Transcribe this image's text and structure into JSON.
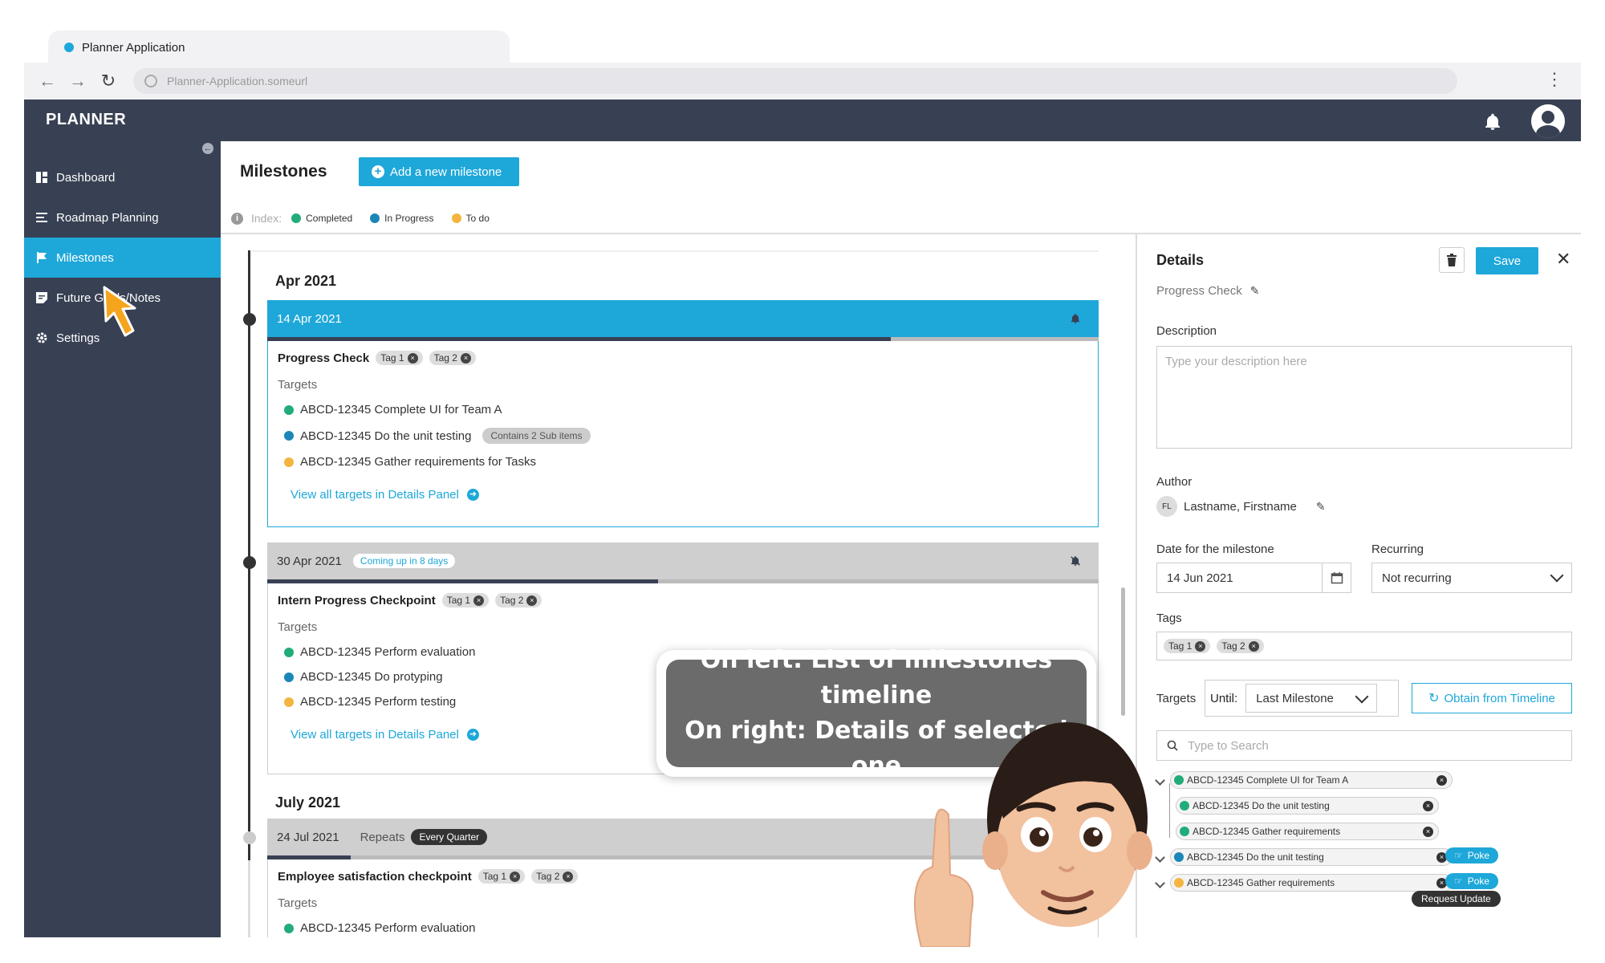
{
  "browser": {
    "tab_title": "Planner Application",
    "url": "Planner-Application.someurl"
  },
  "app": {
    "logo": "PLANNER"
  },
  "sidebar": {
    "items": [
      {
        "label": "Dashboard",
        "icon": "dashboard-icon"
      },
      {
        "label": "Roadmap Planning",
        "icon": "list-icon"
      },
      {
        "label": "Milestones",
        "icon": "flag-icon",
        "active": true
      },
      {
        "label": "Future Goals/Notes",
        "icon": "note-icon"
      },
      {
        "label": "Settings",
        "icon": "gear-icon"
      }
    ]
  },
  "main": {
    "title": "Milestones",
    "add_button": "Add a new milestone",
    "index_label": "Index:",
    "legend": [
      {
        "label": "Completed",
        "color": "#21ac7a"
      },
      {
        "label": "In Progress",
        "color": "#1b86b8"
      },
      {
        "label": "To do",
        "color": "#f3b53f"
      }
    ]
  },
  "timeline": {
    "months": [
      "Apr 2021",
      "July 2021"
    ],
    "milestones": [
      {
        "date": "14 Apr 2021",
        "title": "Progress Check",
        "tags": [
          "Tag 1",
          "Tag 2"
        ],
        "progress": 0.75,
        "targets_label": "Targets",
        "targets": [
          {
            "text": "ABCD-12345 Complete UI for Team A",
            "status": "completed"
          },
          {
            "text": "ABCD-12345 Do the unit testing",
            "status": "in-progress",
            "sub": "Contains 2 Sub items"
          },
          {
            "text": "ABCD-12345 Gather requirements for Tasks",
            "status": "todo"
          }
        ],
        "view_all": "View all targets in Details Panel"
      },
      {
        "date": "30 Apr 2021",
        "badge": "Coming up in 8 days",
        "title": "Intern Progress Checkpoint",
        "tags": [
          "Tag 1",
          "Tag 2"
        ],
        "progress": 0.47,
        "targets_label": "Targets",
        "targets": [
          {
            "text": "ABCD-12345 Perform evaluation",
            "status": "completed"
          },
          {
            "text": "ABCD-12345 Do protyping",
            "status": "in-progress"
          },
          {
            "text": "ABCD-12345 Perform testing",
            "status": "todo"
          }
        ],
        "view_all": "View all targets in Details Panel"
      },
      {
        "date": "24 Jul 2021",
        "repeats": "Repeats",
        "repeat_badge": "Every Quarter",
        "title": "Employee satisfaction checkpoint",
        "tags": [
          "Tag 1",
          "Tag 2"
        ],
        "progress": 0.1,
        "targets_label": "Targets",
        "targets": [
          {
            "text": "ABCD-12345 Perform evaluation",
            "status": "completed"
          }
        ]
      }
    ]
  },
  "details": {
    "title": "Details",
    "save": "Save",
    "name": "Progress Check",
    "description_label": "Description",
    "description_placeholder": "Type your description here",
    "author_label": "Author",
    "author_initials": "FL",
    "author_name": "Lastname, Firstname",
    "date_label": "Date for the milestone",
    "date_value": "14 Jun 2021",
    "recurring_label": "Recurring",
    "recurring_value": "Not recurring",
    "tags_label": "Tags",
    "tags": [
      "Tag 1",
      "Tag 2"
    ],
    "targets_label": "Targets",
    "until_label": "Until:",
    "until_value": "Last Milestone",
    "obtain_button": "Obtain from Timeline",
    "search_placeholder": "Type to Search",
    "tree": [
      {
        "text": "ABCD-12345 Complete UI for Team A",
        "status": "completed",
        "level": 0
      },
      {
        "text": "ABCD-12345 Do the unit testing",
        "status": "completed",
        "level": 1
      },
      {
        "text": "ABCD-12345 Gather requirements",
        "status": "completed",
        "level": 1
      },
      {
        "text": "ABCD-12345 Do the unit testing",
        "status": "in-progress",
        "level": 0,
        "poke": "Poke"
      },
      {
        "text": "ABCD-12345 Gather requirements",
        "status": "todo",
        "level": 0,
        "poke": "Poke"
      }
    ],
    "tooltip": "Request Update"
  },
  "callout": {
    "line1": "On left: List of milestones timeline",
    "line2": "On right: Details of selected one"
  },
  "colors": {
    "accent": "#1ea7d9",
    "sidebar": "#384053",
    "completed": "#21ac7a",
    "in_progress": "#1b86b8",
    "todo": "#f3b53f"
  }
}
